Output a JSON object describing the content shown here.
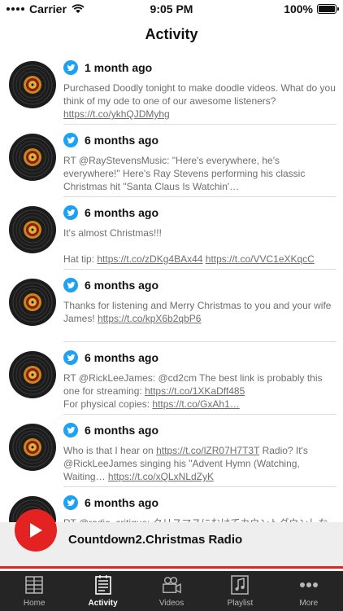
{
  "status": {
    "carrier": "Carrier",
    "time": "9:05 PM",
    "battery": "100%"
  },
  "header": {
    "title": "Activity"
  },
  "feed": [
    {
      "time": "1 month ago",
      "text": "Purchased Doodly tonight to make doodle videos. What do you think of my ode to one of our awesome listeners? ",
      "link": "https://t.co/ykhQJDMyhg"
    },
    {
      "time": "6 months ago",
      "text": "RT @RayStevensMusic: \"Here's everywhere, he's everywhere!\" Here's Ray Stevens performing his classic Christmas hit \"Santa Claus Is Watchin'…",
      "link": ""
    },
    {
      "time": "6 months ago",
      "text": "It's almost Christmas!!!\n\nHat tip: ",
      "link": "https://t.co/zDKg4BAx44",
      "link2": "https://t.co/VVC1eXKqcC"
    },
    {
      "time": "6 months ago",
      "text": "Thanks for listening and Merry Christmas to you and your wife James! ",
      "link": "https://t.co/kpX6b2qbP6"
    },
    {
      "time": "6 months ago",
      "text": "RT @RickLeeJames: @cd2cm The best link is probably this one for streaming: ",
      "link": "https://t.co/1XKaDff485",
      "text2": "\nFor physical copies: ",
      "link2": "https://t.co/GxAh1…"
    },
    {
      "time": "6 months ago",
      "text": "Who is that I hear on ",
      "link": "https://t.co/lZR07H7T3T",
      "text2": " Radio? It's @RickLeeJames singing his \"Advent Hymn (Watching, Waiting… ",
      "link2": "https://t.co/xQLxNLdZyK"
    },
    {
      "time": "6 months ago",
      "text": "RT @radio_critique: クリスマスにむけてカウントダウンしながら、一年中クリスマスソングを流しているカナダのインターネットラジ",
      "link": ""
    }
  ],
  "player": {
    "station": "Countdown2.Christmas Radio",
    "accent": "#e32222"
  },
  "tabs": [
    {
      "label": "Home",
      "icon": "home-grid-icon",
      "active": false
    },
    {
      "label": "Activity",
      "icon": "activity-notes-icon",
      "active": true
    },
    {
      "label": "Videos",
      "icon": "video-camera-icon",
      "active": false
    },
    {
      "label": "Playlist",
      "icon": "playlist-music-icon",
      "active": false
    },
    {
      "label": "More",
      "icon": "more-dots-icon",
      "active": false
    }
  ]
}
